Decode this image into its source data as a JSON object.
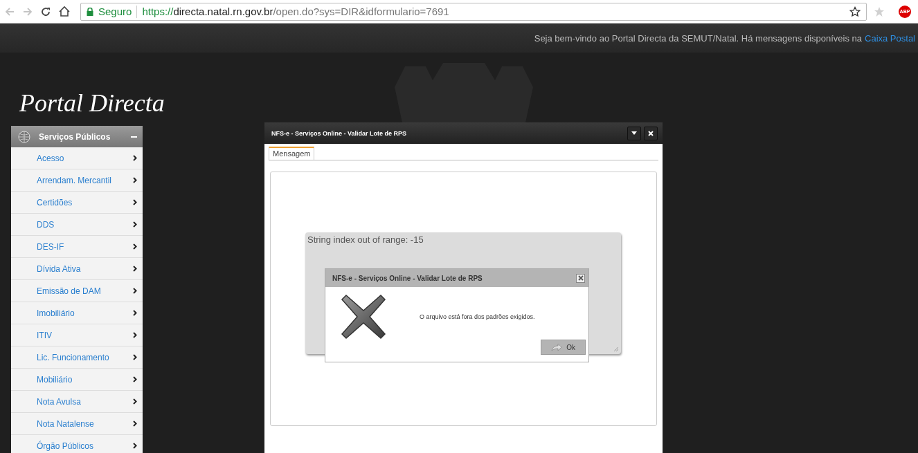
{
  "browser": {
    "security_label": "Seguro",
    "url": {
      "scheme": "https://",
      "host": "directa.natal.rn.gov.br",
      "path": "/open.do?sys=DIR&idformulario=7691"
    },
    "extension_badge": "ABP"
  },
  "header": {
    "welcome": "Seja bem-vindo ao Portal Directa da SEMUT/Natal. Há mensagens disponíveis na",
    "link": "Caixa Postal"
  },
  "logo": "Portal Directa",
  "sidebar": {
    "title": "Serviços Públicos",
    "expanded": true,
    "items": [
      {
        "label": "Acesso"
      },
      {
        "label": "Arrendam. Mercantil"
      },
      {
        "label": "Certidões"
      },
      {
        "label": "DDS"
      },
      {
        "label": "DES-IF"
      },
      {
        "label": "Dívida Ativa"
      },
      {
        "label": "Emissão de DAM"
      },
      {
        "label": "Imobiliário"
      },
      {
        "label": "ITIV"
      },
      {
        "label": "Lic. Funcionamento"
      },
      {
        "label": "Mobiliário"
      },
      {
        "label": "Nota Avulsa"
      },
      {
        "label": "Nota Natalense"
      },
      {
        "label": "Órgão Públicos"
      }
    ]
  },
  "window": {
    "title": "NFS-e - Serviços Online - Validar Lote de RPS",
    "tabs": [
      {
        "label": "Mensagem",
        "selected": true
      }
    ],
    "error_text": "String index out of range: -15",
    "dialog": {
      "title": "NFS-e - Serviços Online - Validar Lote de RPS",
      "message": "O arquivo está fora dos padrões exigidos.",
      "button": "Ok"
    }
  }
}
